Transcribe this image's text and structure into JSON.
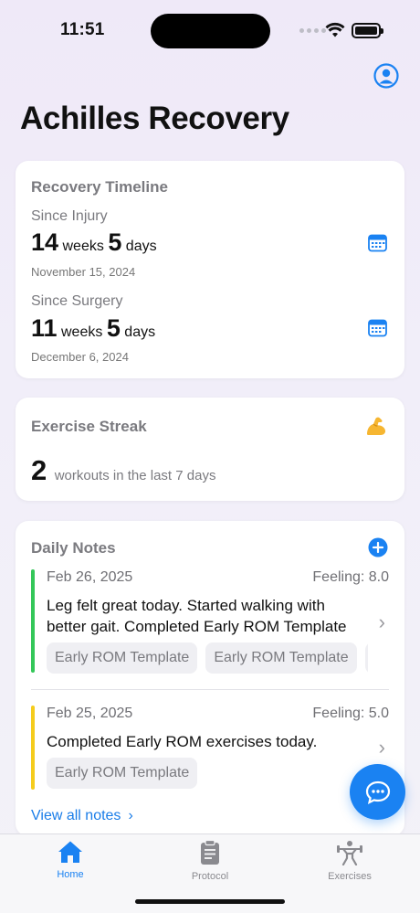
{
  "status_bar": {
    "time": "11:51"
  },
  "app": {
    "title": "Achilles Recovery"
  },
  "timeline": {
    "title": "Recovery Timeline",
    "injury": {
      "label": "Since Injury",
      "weeks": "14",
      "weeks_unit": "weeks",
      "days": "5",
      "days_unit": "days",
      "date": "November 15, 2024"
    },
    "surgery": {
      "label": "Since Surgery",
      "weeks": "11",
      "weeks_unit": "weeks",
      "days": "5",
      "days_unit": "days",
      "date": "December 6, 2024"
    }
  },
  "streak": {
    "title": "Exercise Streak",
    "count": "2",
    "text": "workouts in the last 7 days"
  },
  "notes": {
    "title": "Daily Notes",
    "items": [
      {
        "date": "Feb 26, 2025",
        "feeling": "Feeling: 8.0",
        "text": "Leg felt great today. Started walking with better gait. Completed Early ROM Template",
        "tags": [
          "Early ROM Template",
          "Early ROM Template",
          "E"
        ],
        "color": "#34c759"
      },
      {
        "date": "Feb 25, 2025",
        "feeling": "Feeling: 5.0",
        "text": "Completed Early ROM exercises today.",
        "tags": [
          "Early ROM Template"
        ],
        "color": "#f5cc1d"
      }
    ],
    "view_all": "View all notes"
  },
  "tabs": [
    {
      "label": "Home",
      "icon": "house-icon",
      "active": true
    },
    {
      "label": "Protocol",
      "icon": "clipboard-icon",
      "active": false
    },
    {
      "label": "Exercises",
      "icon": "weightlifter-icon",
      "active": false
    }
  ],
  "colors": {
    "accent": "#1a82f2",
    "note_green": "#34c759",
    "note_yellow": "#f5cc1d"
  }
}
